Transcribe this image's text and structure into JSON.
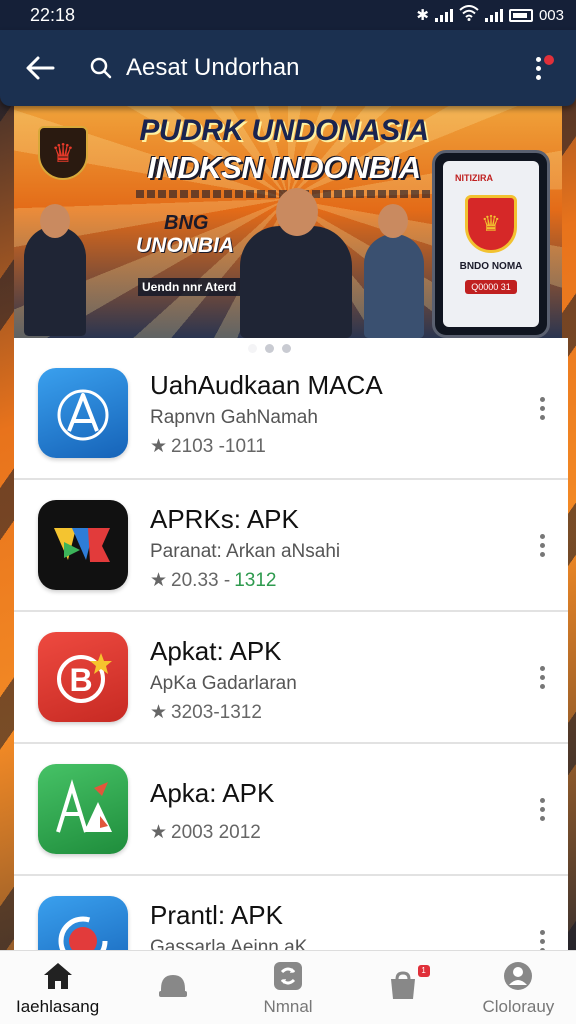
{
  "status_bar": {
    "time": "22:18",
    "right_text": "003"
  },
  "app_bar": {
    "back_icon": "arrow-left-icon",
    "search_value": "Aesat Undorhan",
    "menu_icon": "more-vert-icon"
  },
  "banner": {
    "title_line1": "PUDRK UNDONASIA",
    "title_line2": "INDKSN INDONBIA",
    "tag_line1": "BNG",
    "tag_line2": "UNONBIA",
    "small_text": "Uendn nnr Aterd",
    "phone_brand": "NITIZIRA",
    "phone_text": "BNDO NOMA",
    "phone_pill": "Q0000 31",
    "page_count": 3,
    "active_page": 0
  },
  "apps": [
    {
      "name": "UahAudkaan MACA",
      "subtitle": "Rapnvn GahNamah",
      "rating": "2103 -1011",
      "rating_green": "",
      "icon": "blue-a-icon",
      "colors": [
        "#2f8ee0",
        "#1663b8"
      ]
    },
    {
      "name": "APRKs: APK",
      "subtitle": "Paranat: Arkan aNsahi",
      "rating": "20.33 -",
      "rating_green": "1312",
      "icon": "colorful-vn-icon",
      "colors": [
        "#111111",
        "#111111"
      ]
    },
    {
      "name": "Apkat: APK",
      "subtitle": "ApKa Gadarlaran",
      "rating": "3203-1312",
      "rating_green": "",
      "icon": "red-b-icon",
      "colors": [
        "#e4433a",
        "#c72a23"
      ]
    },
    {
      "name": "Apka: APK",
      "subtitle": "",
      "rating": "2003 2012",
      "rating_green": "",
      "icon": "green-a-icon",
      "colors": [
        "#3cb45a",
        "#1f8d3c"
      ]
    },
    {
      "name": "Prantl: APK",
      "subtitle": "Gassarla Aeinn aK",
      "rating": "",
      "rating_green": "",
      "icon": "blue-circle-icon",
      "colors": [
        "#2f8ee0",
        "#1663b8"
      ]
    }
  ],
  "bottom_nav": [
    {
      "label": "Iaehlasang",
      "icon": "home-icon",
      "active": true
    },
    {
      "label": "",
      "icon": "chat-icon",
      "active": false
    },
    {
      "label": "Nmnal",
      "icon": "refresh-icon",
      "active": false
    },
    {
      "label": "",
      "icon": "store-icon",
      "active": false,
      "badge": "1"
    },
    {
      "label": "Clolorauy",
      "icon": "profile-icon",
      "active": false
    }
  ]
}
